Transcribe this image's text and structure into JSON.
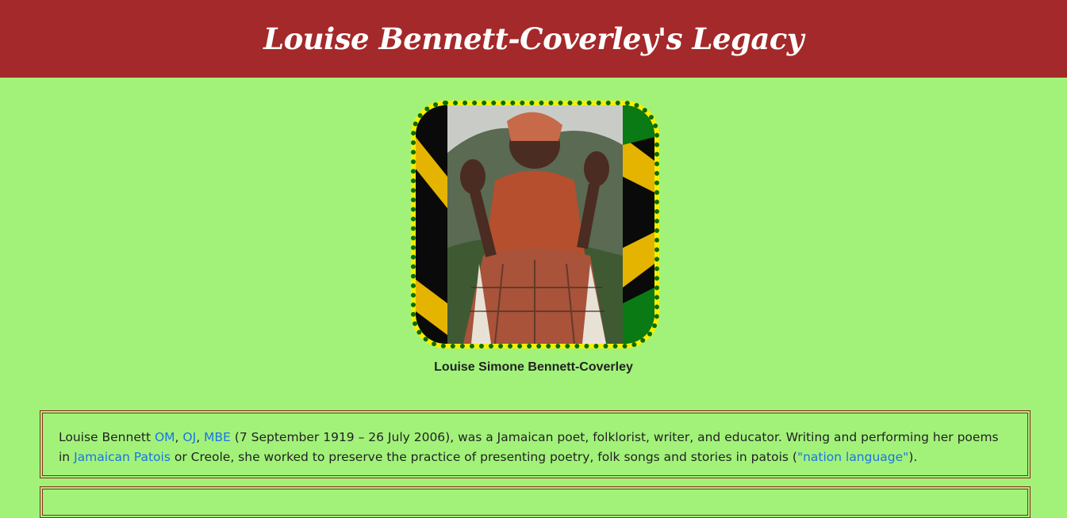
{
  "header": {
    "title": "Louise Bennett-Coverley's Legacy"
  },
  "portrait": {
    "caption": "Louise Simone Bennett-Coverley"
  },
  "bio": {
    "name": "Louise Bennett",
    "link_om": "OM",
    "sep1": ", ",
    "link_oj": "OJ",
    "sep2": ", ",
    "link_mbe": "MBE",
    "text1": " (7 September 1919 – 26 July 2006), was a Jamaican poet, folklorist, writer, and educator. Writing and performing her poems in ",
    "link_patois": "Jamaican Patois",
    "text2": " or Creole, she worked to preserve the practice of presenting poetry, folk songs and stories in patois (",
    "link_nation": "\"nation language\"",
    "text3": ")."
  },
  "colors": {
    "header_bg": "#a4292a",
    "page_bg": "#a2f27a",
    "link": "#1a73e8",
    "box_border": "#8b2b1f",
    "frame_dots": "#0b6b0b",
    "frame_fill": "#f3f000"
  }
}
